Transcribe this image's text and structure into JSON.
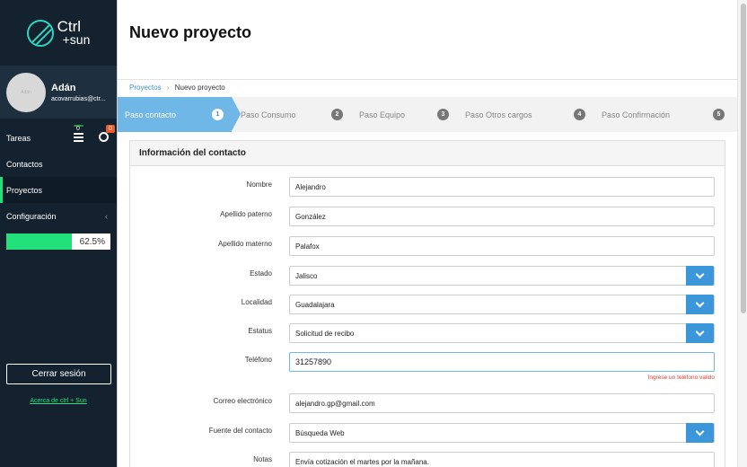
{
  "app": {
    "logo_line1": "Ctrl",
    "logo_line2": "+sun",
    "accent_color": "#22e07a",
    "primary_color": "#3b97d9"
  },
  "user": {
    "avatar_text": "Adán",
    "name": "Adán",
    "email": "acovarrubias@ctr..."
  },
  "sidebar": {
    "items": [
      {
        "label": "Tareas",
        "tasks_badge": "0",
        "alerts_badge": "0",
        "icons": [
          "list-icon",
          "clock-icon"
        ]
      },
      {
        "label": "Contactos"
      },
      {
        "label": "Proyectos",
        "active": true
      },
      {
        "label": "Configuración",
        "chevron": "‹"
      }
    ],
    "progress_value": 0.625,
    "progress_text": "62.5%",
    "logout_label": "Cerrar sesión",
    "about_label": "Acerca de ctrl + Sun"
  },
  "main": {
    "title": "Nuevo proyecto",
    "breadcrumb": {
      "link": "Proyectos",
      "separator": "›",
      "current": "Nuevo proyecto"
    },
    "steps": [
      {
        "label": "Paso contacto",
        "number": "1",
        "active": true
      },
      {
        "label": "Paso Consumo",
        "number": "2"
      },
      {
        "label": "Paso Equipo",
        "number": "3"
      },
      {
        "label": "Paso Otros cargos",
        "number": "4"
      },
      {
        "label": "Paso Confirmación",
        "number": "5"
      }
    ],
    "card_title": "Información del contacto",
    "fields": [
      {
        "label": "Nombre",
        "value": "Alejandro",
        "type": "text"
      },
      {
        "label": "Apellido paterno",
        "value": "González",
        "type": "text"
      },
      {
        "label": "Apellido materno",
        "value": "Palafox",
        "type": "text"
      },
      {
        "label": "Estado",
        "value": "Jalisco",
        "type": "select"
      },
      {
        "label": "Localidad",
        "value": "Guadalajara",
        "type": "select"
      },
      {
        "label": "Estatus",
        "value": "Solicitud de recibo",
        "type": "select"
      },
      {
        "label": "Teléfono",
        "value": "31257890",
        "type": "text",
        "error": "Ingrese un teléfono valido"
      },
      {
        "label": "Correo electrónico",
        "value": "alejandro.gp@gmail.com",
        "type": "text"
      },
      {
        "label": "Fuente del contacto",
        "value": "Búsqueda Web",
        "type": "select"
      },
      {
        "label": "Notas",
        "value": "Envía cotización el martes por la mañana.",
        "type": "textarea"
      }
    ]
  }
}
